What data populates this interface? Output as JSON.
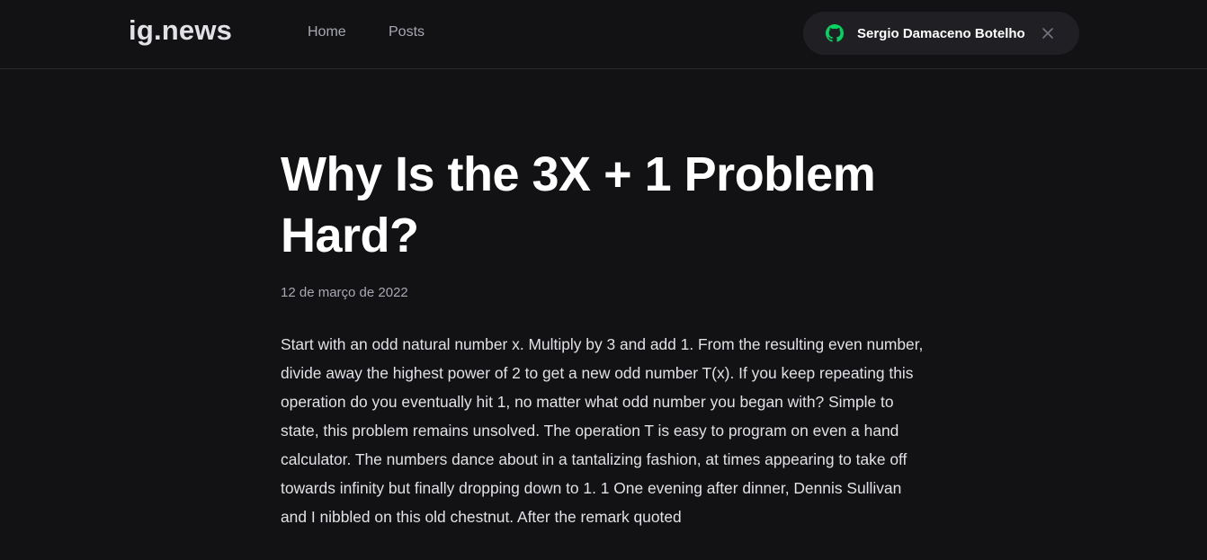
{
  "header": {
    "logo": "ig.news",
    "nav": [
      {
        "label": "Home"
      },
      {
        "label": "Posts"
      }
    ],
    "signin": {
      "user_name": "Sergio Damaceno Botelho",
      "icon": "github-icon",
      "close_icon": "close-icon",
      "icon_color": "#04d361"
    }
  },
  "article": {
    "title": "Why Is the 3X + 1 Problem Hard?",
    "date": "12 de março de 2022",
    "excerpt": "Start with an odd natural number x. Multiply by 3 and add 1. From the resulting even number, divide away the highest power of 2 to get a new odd number T(x). If you keep repeating this operation do you eventually hit 1, no matter what odd number you began with? Simple to state, this problem remains unsolved. The operation T is easy to program on even a hand calculator. The numbers dance about in a tantalizing fashion, at times appearing to take off towards infinity but finally dropping down to 1. 1 One evening after dinner, Dennis Sullivan and I nibbled on this old chestnut. After the remark quoted"
  },
  "colors": {
    "background": "#121214",
    "header_border": "#29292e",
    "button_bg": "#202024",
    "accent": "#04d361"
  }
}
